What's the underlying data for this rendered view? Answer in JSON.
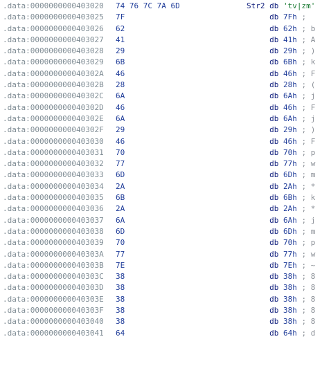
{
  "colors": {
    "background": "#ffffff",
    "address": "#7f8c94",
    "bytes": "#1f3c99",
    "mnemonic": "#0b1a7a",
    "string": "#1a7a33",
    "comment": "#8a8f96"
  },
  "rows": [
    {
      "addr": ".data:0000000000403020",
      "bytes": "74 76 7C 7A 6D",
      "name": "Str2",
      "mnem": "db",
      "operand": "'tv|zm'",
      "comment": ""
    },
    {
      "addr": ".data:0000000000403025",
      "bytes": "7F",
      "name": "",
      "mnem": "db",
      "operand": "7Fh",
      "comment": ";"
    },
    {
      "addr": ".data:0000000000403026",
      "bytes": "62",
      "name": "",
      "mnem": "db",
      "operand": "62h",
      "comment": "; b"
    },
    {
      "addr": ".data:0000000000403027",
      "bytes": "41",
      "name": "",
      "mnem": "db",
      "operand": "41h",
      "comment": "; A"
    },
    {
      "addr": ".data:0000000000403028",
      "bytes": "29",
      "name": "",
      "mnem": "db",
      "operand": "29h",
      "comment": "; )"
    },
    {
      "addr": ".data:0000000000403029",
      "bytes": "6B",
      "name": "",
      "mnem": "db",
      "operand": "6Bh",
      "comment": "; k"
    },
    {
      "addr": ".data:000000000040302A",
      "bytes": "46",
      "name": "",
      "mnem": "db",
      "operand": "46h",
      "comment": "; F"
    },
    {
      "addr": ".data:000000000040302B",
      "bytes": "28",
      "name": "",
      "mnem": "db",
      "operand": "28h",
      "comment": "; ("
    },
    {
      "addr": ".data:000000000040302C",
      "bytes": "6A",
      "name": "",
      "mnem": "db",
      "operand": "6Ah",
      "comment": "; j"
    },
    {
      "addr": ".data:000000000040302D",
      "bytes": "46",
      "name": "",
      "mnem": "db",
      "operand": "46h",
      "comment": "; F"
    },
    {
      "addr": ".data:000000000040302E",
      "bytes": "6A",
      "name": "",
      "mnem": "db",
      "operand": "6Ah",
      "comment": "; j"
    },
    {
      "addr": ".data:000000000040302F",
      "bytes": "29",
      "name": "",
      "mnem": "db",
      "operand": "29h",
      "comment": "; )"
    },
    {
      "addr": ".data:0000000000403030",
      "bytes": "46",
      "name": "",
      "mnem": "db",
      "operand": "46h",
      "comment": "; F"
    },
    {
      "addr": ".data:0000000000403031",
      "bytes": "70",
      "name": "",
      "mnem": "db",
      "operand": "70h",
      "comment": "; p"
    },
    {
      "addr": ".data:0000000000403032",
      "bytes": "77",
      "name": "",
      "mnem": "db",
      "operand": "77h",
      "comment": "; w"
    },
    {
      "addr": ".data:0000000000403033",
      "bytes": "6D",
      "name": "",
      "mnem": "db",
      "operand": "6Dh",
      "comment": "; m"
    },
    {
      "addr": ".data:0000000000403034",
      "bytes": "2A",
      "name": "",
      "mnem": "db",
      "operand": "2Ah",
      "comment": "; *"
    },
    {
      "addr": ".data:0000000000403035",
      "bytes": "6B",
      "name": "",
      "mnem": "db",
      "operand": "6Bh",
      "comment": "; k"
    },
    {
      "addr": ".data:0000000000403036",
      "bytes": "2A",
      "name": "",
      "mnem": "db",
      "operand": "2Ah",
      "comment": "; *"
    },
    {
      "addr": ".data:0000000000403037",
      "bytes": "6A",
      "name": "",
      "mnem": "db",
      "operand": "6Ah",
      "comment": "; j"
    },
    {
      "addr": ".data:0000000000403038",
      "bytes": "6D",
      "name": "",
      "mnem": "db",
      "operand": "6Dh",
      "comment": "; m"
    },
    {
      "addr": ".data:0000000000403039",
      "bytes": "70",
      "name": "",
      "mnem": "db",
      "operand": "70h",
      "comment": "; p"
    },
    {
      "addr": ".data:000000000040303A",
      "bytes": "77",
      "name": "",
      "mnem": "db",
      "operand": "77h",
      "comment": "; w"
    },
    {
      "addr": ".data:000000000040303B",
      "bytes": "7E",
      "name": "",
      "mnem": "db",
      "operand": "7Eh",
      "comment": "; ~"
    },
    {
      "addr": ".data:000000000040303C",
      "bytes": "38",
      "name": "",
      "mnem": "db",
      "operand": "38h",
      "comment": "; 8"
    },
    {
      "addr": ".data:000000000040303D",
      "bytes": "38",
      "name": "",
      "mnem": "db",
      "operand": "38h",
      "comment": "; 8"
    },
    {
      "addr": ".data:000000000040303E",
      "bytes": "38",
      "name": "",
      "mnem": "db",
      "operand": "38h",
      "comment": "; 8"
    },
    {
      "addr": ".data:000000000040303F",
      "bytes": "38",
      "name": "",
      "mnem": "db",
      "operand": "38h",
      "comment": "; 8"
    },
    {
      "addr": ".data:0000000000403040",
      "bytes": "38",
      "name": "",
      "mnem": "db",
      "operand": "38h",
      "comment": "; 8"
    },
    {
      "addr": ".data:0000000000403041",
      "bytes": "64",
      "name": "",
      "mnem": "db",
      "operand": "64h",
      "comment": "; d"
    }
  ]
}
